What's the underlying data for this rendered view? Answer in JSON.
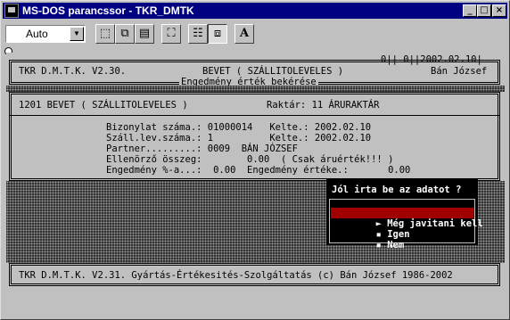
{
  "window": {
    "title": "MS-DOS parancssor - TKR_DMTK",
    "controls": [
      "minimize",
      "maximize",
      "close"
    ]
  },
  "toolbar": {
    "font_size_value": "Auto",
    "tools": [
      "mark-icon",
      "copy-icon",
      "paste-icon",
      "fullscreen-icon",
      "properties-icon",
      "background-icon",
      "font-icon"
    ],
    "font_tool_label": "A"
  },
  "console": {
    "header": {
      "top_right": "0|| 0||2002.02.10|",
      "left": "TKR D.M.T.K. V2.30.",
      "center": "BEVET ( SZÁLLITOLEVELES )",
      "right": "Bán József",
      "subtitle": "Engedmény érték bekérése"
    },
    "panel": {
      "title": "1201 BEVET ( SZÁLLITOLEVELES )",
      "warehouse": "Raktár: 11 ÁRURAKTÁR",
      "rows": [
        "Bizonylat száma.: 01000014   Kelte.: 2002.02.10",
        "Száll.lev.száma.: 1          Kelte.: 2002.02.10",
        "Partner.........: 0009  BÁN JÓZSEF",
        "Ellenörző összeg:        0.00  ( Csak áruérték!!! )",
        "Engedmény %-a...:  0.00  Engedmény értéke.:       0.00"
      ]
    },
    "dialog": {
      "title": "Jól irta be az adatot ?",
      "options": [
        {
          "label": "Még javitani kell",
          "marker": "►",
          "selected": true
        },
        {
          "label": "Igen",
          "marker": "▪",
          "selected": false
        },
        {
          "label": "Nem",
          "marker": "▪",
          "selected": false
        }
      ]
    },
    "footer": "TKR D.M.T.K. V2.31. Gyártás-Értékesités-Szolgáltatás (c) Bán József 1986-2002"
  }
}
